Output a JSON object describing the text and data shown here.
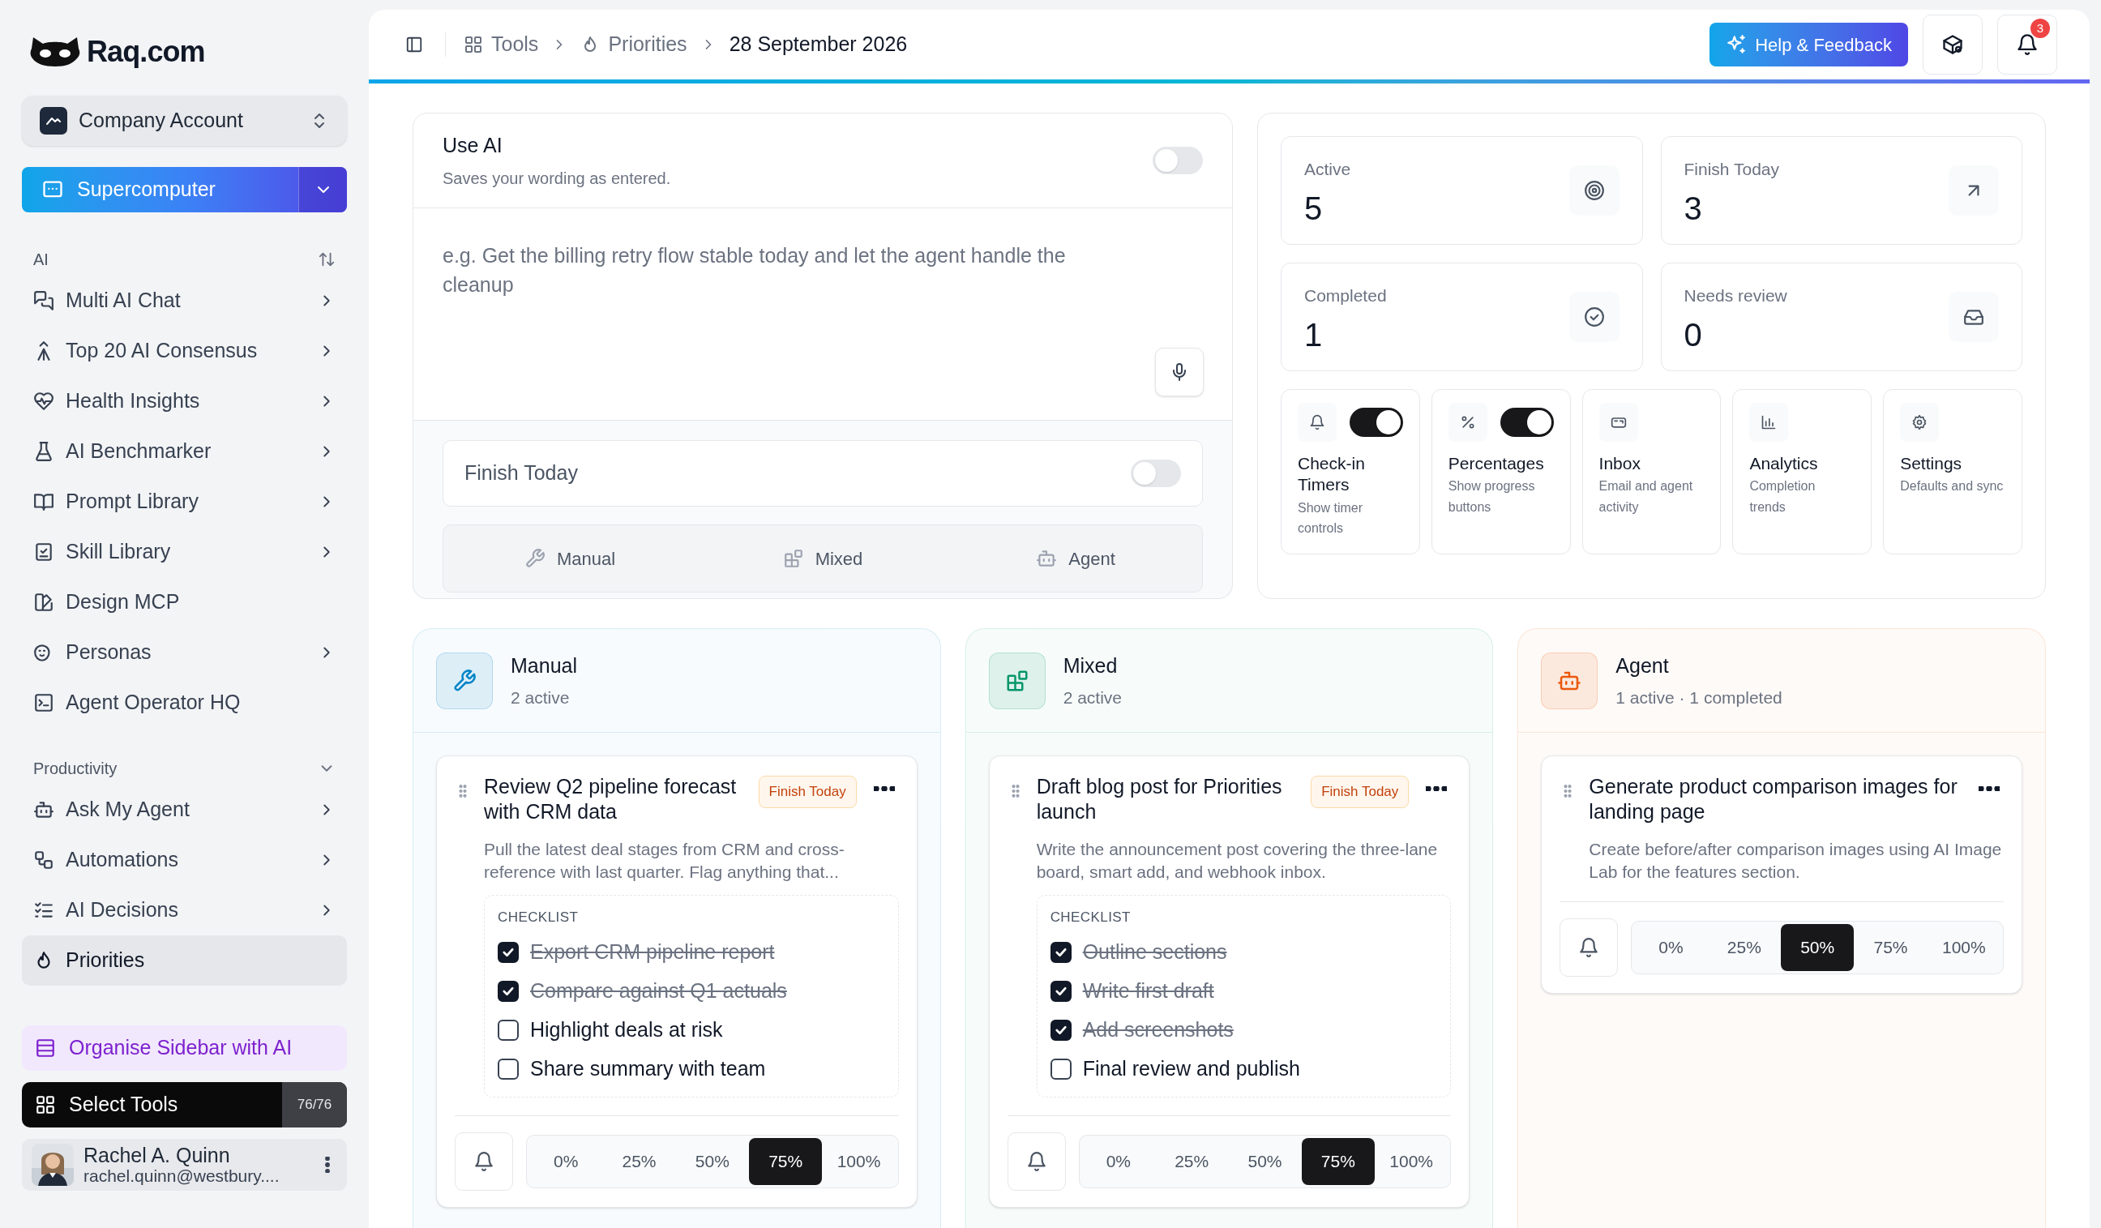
{
  "sidebar": {
    "logo": "Raq.com",
    "account": "Company Account",
    "primary_button": "Supercomputer",
    "sections": [
      {
        "title": "AI",
        "items": [
          {
            "label": "Multi AI Chat",
            "chevron": true,
            "selected": false
          },
          {
            "label": "Top 20 AI Consensus",
            "chevron": true,
            "selected": false
          },
          {
            "label": "Health Insights",
            "chevron": true,
            "selected": false
          },
          {
            "label": "AI Benchmarker",
            "chevron": true,
            "selected": false
          },
          {
            "label": "Prompt Library",
            "chevron": true,
            "selected": false
          },
          {
            "label": "Skill Library",
            "chevron": true,
            "selected": false
          },
          {
            "label": "Design MCP",
            "chevron": false,
            "selected": false
          },
          {
            "label": "Personas",
            "chevron": true,
            "selected": false
          },
          {
            "label": "Agent Operator HQ",
            "chevron": false,
            "selected": false
          }
        ]
      },
      {
        "title": "Productivity",
        "items": [
          {
            "label": "Ask My Agent",
            "chevron": true,
            "selected": false
          },
          {
            "label": "Automations",
            "chevron": true,
            "selected": false
          },
          {
            "label": "AI Decisions",
            "chevron": true,
            "selected": false
          },
          {
            "label": "Priorities",
            "chevron": false,
            "selected": true
          }
        ]
      }
    ],
    "organise": "Organise Sidebar with AI",
    "select_tools": {
      "label": "Select Tools",
      "count": "76/76"
    },
    "user": {
      "name": "Rachel A. Quinn",
      "email": "rachel.quinn@westbury...."
    }
  },
  "breadcrumb": [
    {
      "label": "Tools",
      "current": false
    },
    {
      "label": "Priorities",
      "current": false
    },
    {
      "label": "28 September 2026",
      "current": true
    }
  ],
  "help_button": "Help & Feedback",
  "notification_count": "3",
  "compose": {
    "use_ai": {
      "title": "Use AI",
      "subtitle": "Saves your wording as entered.",
      "on": false
    },
    "placeholder": "e.g. Get the billing retry flow stable today and let the agent handle the cleanup",
    "finish_today": {
      "label": "Finish Today",
      "on": false
    },
    "modes": [
      "Manual",
      "Mixed",
      "Agent"
    ]
  },
  "stats": [
    {
      "label": "Active",
      "value": "5"
    },
    {
      "label": "Finish Today",
      "value": "3"
    },
    {
      "label": "Completed",
      "value": "1"
    },
    {
      "label": "Needs review",
      "value": "0"
    }
  ],
  "features": [
    {
      "title": "Check-in Timers",
      "subtitle": "Show timer controls",
      "kind": "toggle",
      "on": true
    },
    {
      "title": "Percentages",
      "subtitle": "Show progress buttons",
      "kind": "toggle",
      "on": true
    },
    {
      "title": "Inbox",
      "subtitle": "Email and agent activity",
      "kind": "link"
    },
    {
      "title": "Analytics",
      "subtitle": "Completion trends",
      "kind": "link"
    },
    {
      "title": "Settings",
      "subtitle": "Defaults and sync",
      "kind": "link"
    }
  ],
  "lanes": [
    {
      "title": "Manual",
      "subtitle": "2 active",
      "color": "#0284c7",
      "cards": [
        {
          "title": "Review Q2 pipeline forecast with CRM data",
          "badge": "Finish Today",
          "description": "Pull the latest deal stages from CRM and cross-reference with last quarter. Flag anything that...",
          "checklist": {
            "label": "CHECKLIST",
            "items": [
              {
                "label": "Export CRM pipeline report",
                "checked": true
              },
              {
                "label": "Compare against Q1 actuals",
                "checked": true
              },
              {
                "label": "Highlight deals at risk",
                "checked": false
              },
              {
                "label": "Share summary with team",
                "checked": false
              }
            ]
          },
          "progress": [
            {
              "label": "0%",
              "selected": false
            },
            {
              "label": "25%",
              "selected": false
            },
            {
              "label": "50%",
              "selected": false
            },
            {
              "label": "75%",
              "selected": true
            },
            {
              "label": "100%",
              "selected": false
            }
          ]
        }
      ]
    },
    {
      "title": "Mixed",
      "subtitle": "2 active",
      "color": "#059669",
      "cards": [
        {
          "title": "Draft blog post for Priorities launch",
          "badge": "Finish Today",
          "description": "Write the announcement post covering the three-lane board, smart add, and webhook inbox.",
          "checklist": {
            "label": "CHECKLIST",
            "items": [
              {
                "label": "Outline sections",
                "checked": true
              },
              {
                "label": "Write first draft",
                "checked": true
              },
              {
                "label": "Add screenshots",
                "checked": true
              },
              {
                "label": "Final review and publish",
                "checked": false
              }
            ]
          },
          "progress": [
            {
              "label": "0%",
              "selected": false
            },
            {
              "label": "25%",
              "selected": false
            },
            {
              "label": "50%",
              "selected": false
            },
            {
              "label": "75%",
              "selected": true
            },
            {
              "label": "100%",
              "selected": false
            }
          ]
        }
      ]
    },
    {
      "title": "Agent",
      "subtitle": "1 active · 1 completed",
      "color": "#ea580c",
      "cards": [
        {
          "title": "Generate product comparison images for landing page",
          "description": "Create before/after comparison images using AI Image Lab for the features section.",
          "progress": [
            {
              "label": "0%",
              "selected": false
            },
            {
              "label": "25%",
              "selected": false
            },
            {
              "label": "50%",
              "selected": true
            },
            {
              "label": "75%",
              "selected": false
            },
            {
              "label": "100%",
              "selected": false
            }
          ]
        }
      ]
    }
  ]
}
